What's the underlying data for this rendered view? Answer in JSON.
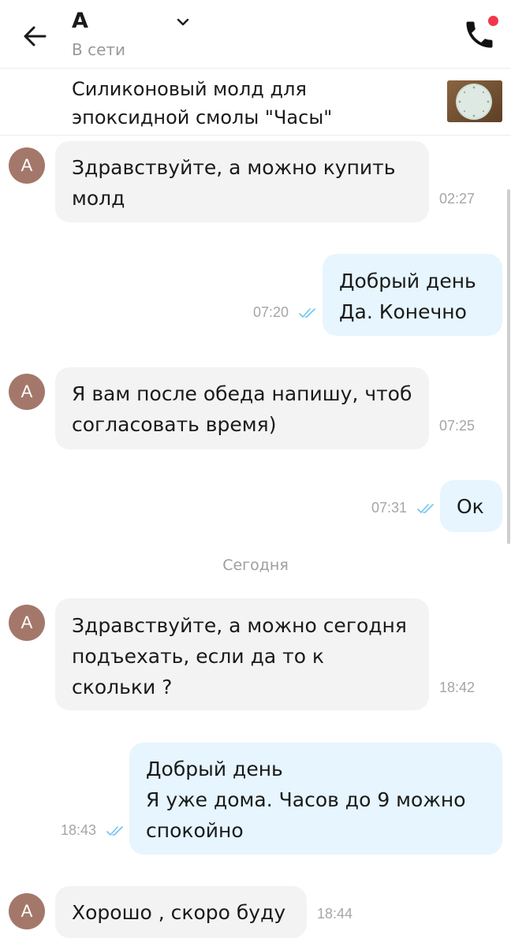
{
  "header": {
    "name": "А",
    "status": "В сети"
  },
  "listing": {
    "title": "Силиконовый молд для эпоксидной смолы \"Часы\""
  },
  "colors": {
    "incoming_bubble": "#f3f3f3",
    "outgoing_bubble": "#e6f5fe",
    "avatar": "#a3786a",
    "online_dot": "#f0374b",
    "read_ticks": "#6ec6ee"
  },
  "date_separator": "Сегодня",
  "messages": [
    {
      "direction": "in",
      "avatar": "А",
      "text": "Здравствуйте, а можно купить\nмолд",
      "time": "02:27"
    },
    {
      "direction": "out",
      "text": "Добрый день\nДа. Конечно",
      "time": "07:20",
      "status": "read"
    },
    {
      "direction": "in",
      "avatar": "А",
      "text": "Я вам после обеда напишу, чтоб\nсогласовать время)",
      "time": "07:25"
    },
    {
      "direction": "out",
      "text": "Ок",
      "time": "07:31",
      "status": "read"
    },
    {
      "direction": "in",
      "avatar": "А",
      "text": "Здравствуйте, а можно сегодня\nподъехать, если да то к\nскольки ?",
      "time": "18:42"
    },
    {
      "direction": "out",
      "text": "Добрый день\nЯ уже дома. Часов до 9 можно\nспокойно",
      "time": "18:43",
      "status": "read"
    },
    {
      "direction": "in",
      "avatar": "А",
      "text": "Хорошо , скоро буду",
      "time": "18:44"
    }
  ]
}
